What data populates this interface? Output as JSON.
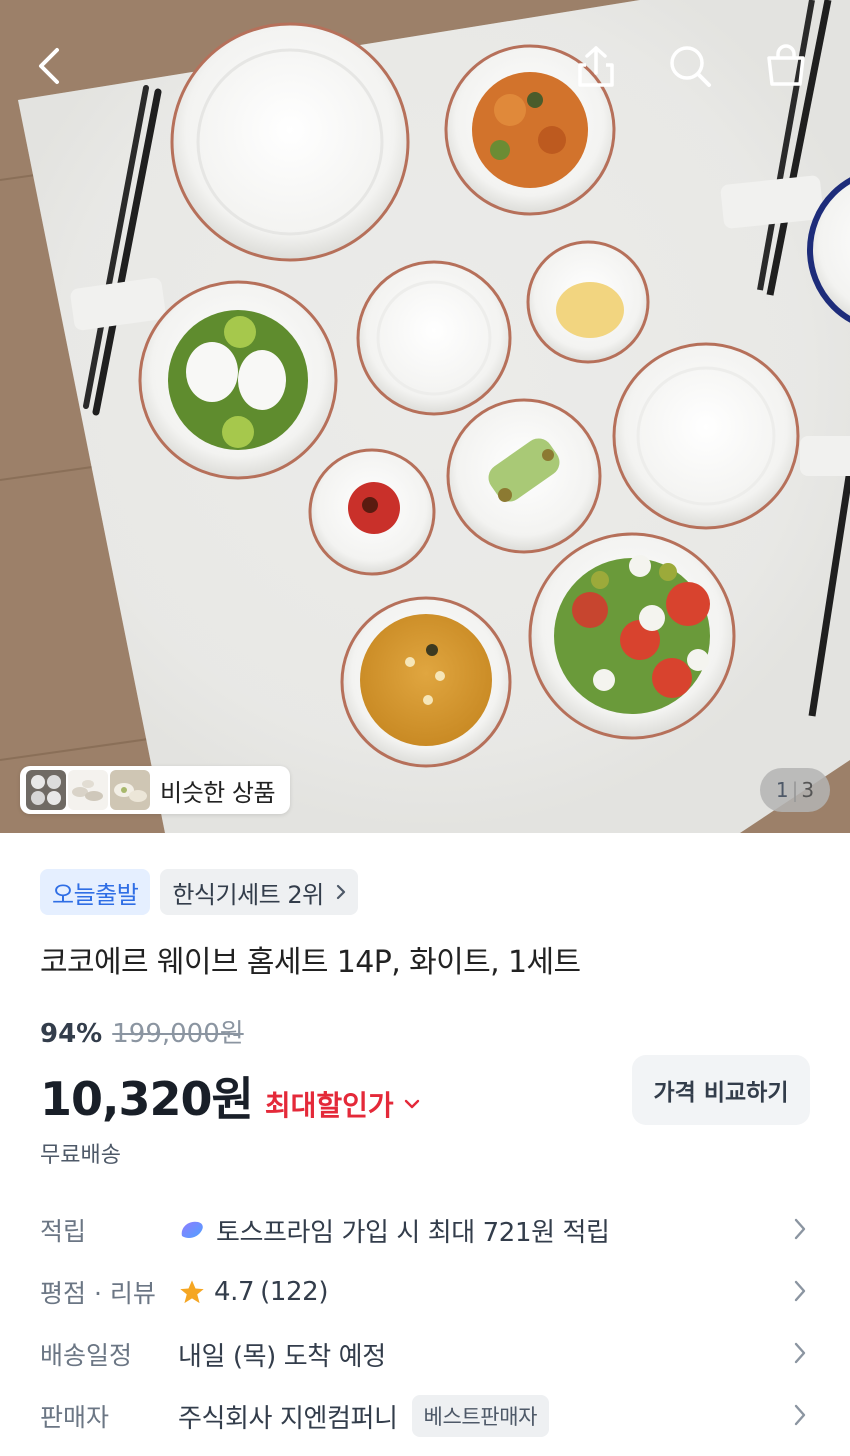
{
  "header": {
    "back_icon": "chevron-left-icon",
    "share_icon": "share-upload-icon",
    "search_icon": "search-icon",
    "cart_icon": "shopping-bag-icon"
  },
  "gallery": {
    "similar_label": "비슷한 상품",
    "current_page": "1",
    "total_pages": "3"
  },
  "product": {
    "badge_today": "오늘출발",
    "badge_rank": "한식기세트 2위",
    "title": "코코에르 웨이브 홈세트 14P, 화이트, 1세트",
    "discount_percent": "94%",
    "original_price": "199,000원",
    "price": "10,320원",
    "max_discount_label": "최대할인가",
    "compare_button": "가격 비교하기",
    "shipping": "무료배송"
  },
  "details": {
    "points_label": "적립",
    "points_value": "토스프라임 가입 시 최대 721원 적립",
    "rating_label": "평점 · 리뷰",
    "rating_value": "4.7",
    "review_count": "(122)",
    "delivery_label": "배송일정",
    "delivery_value": "내일 (목) 도착 예정",
    "seller_label": "판매자",
    "seller_value": "주식회사 지엔컴퍼니",
    "seller_badge": "베스트판매자"
  },
  "colors": {
    "accent_blue": "#2f6ee5",
    "discount_red": "#e42939",
    "star": "#f5a623"
  }
}
